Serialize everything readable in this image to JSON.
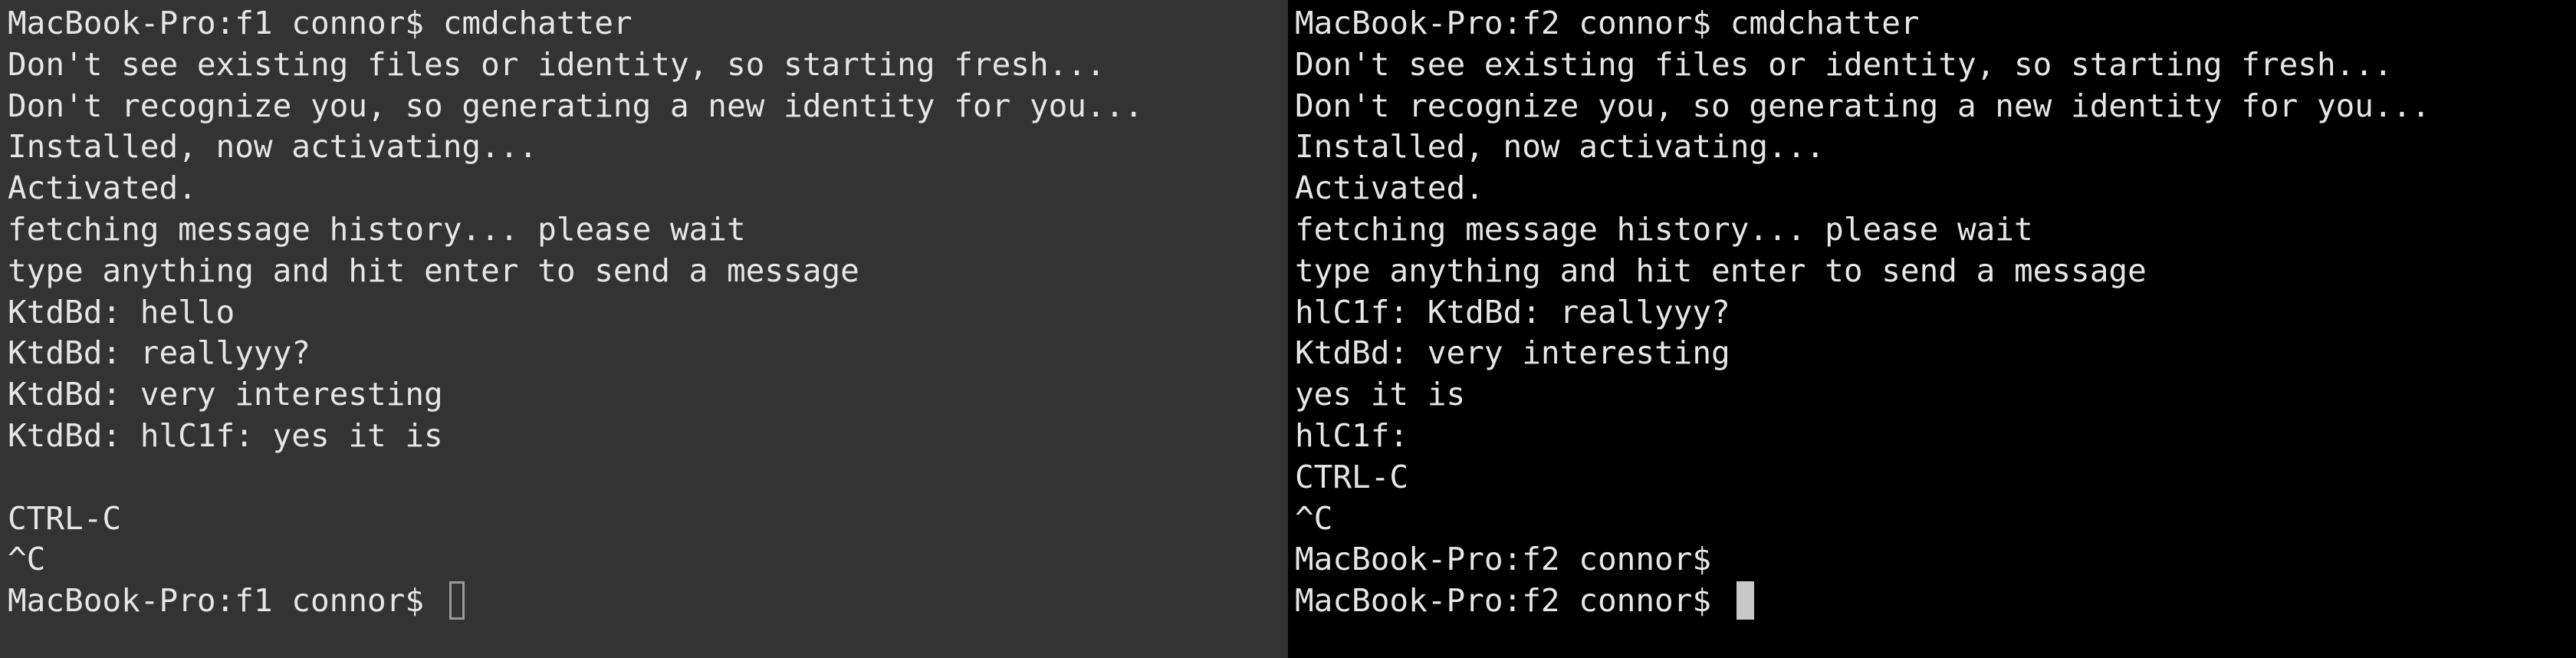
{
  "left_terminal": {
    "lines": [
      "MacBook-Pro:f1 connor$ cmdchatter",
      "Don't see existing files or identity, so starting fresh...",
      "Don't recognize you, so generating a new identity for you...",
      "Installed, now activating...",
      "Activated.",
      "fetching message history... please wait",
      "type anything and hit enter to send a message",
      "KtdBd: hello",
      "KtdBd: reallyyy?",
      "KtdBd: very interesting",
      "KtdBd: hlC1f: yes it is",
      "",
      "CTRL-C",
      "^C",
      "MacBook-Pro:f1 connor$ "
    ],
    "background": "#333333"
  },
  "right_terminal": {
    "lines": [
      "MacBook-Pro:f2 connor$ cmdchatter",
      "Don't see existing files or identity, so starting fresh...",
      "Don't recognize you, so generating a new identity for you...",
      "Installed, now activating...",
      "Activated.",
      "fetching message history... please wait",
      "type anything and hit enter to send a message",
      "hlC1f: KtdBd: reallyyy?",
      "KtdBd: very interesting",
      "yes it is",
      "hlC1f:",
      "CTRL-C",
      "^C",
      "MacBook-Pro:f2 connor$",
      "MacBook-Pro:f2 connor$ "
    ],
    "background": "#000000"
  }
}
